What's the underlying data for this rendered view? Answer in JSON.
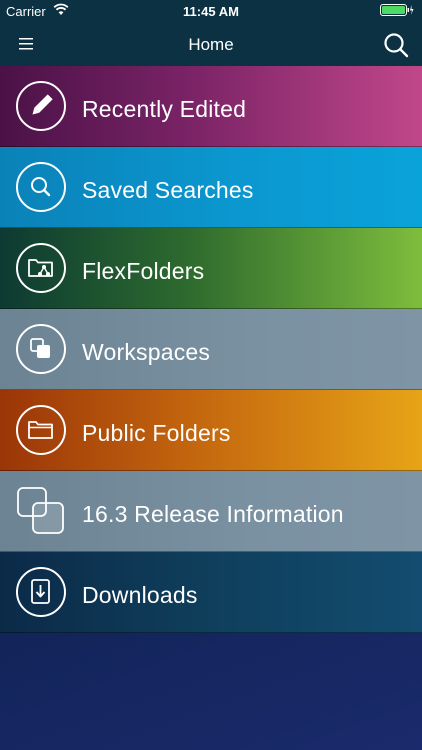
{
  "status_bar": {
    "carrier": "Carrier",
    "time": "11:45 AM",
    "icons": [
      "wifi-icon",
      "battery-icon"
    ]
  },
  "nav": {
    "title": "Home",
    "icons": [
      "hamburger-menu-icon",
      "search-icon"
    ]
  },
  "colors": {
    "nav_bg": "#0b3142",
    "icon_stroke": "#ffffff"
  },
  "menu": [
    {
      "label": "Recently Edited",
      "icon": "pencil-icon"
    },
    {
      "label": "Saved Searches",
      "icon": "search-icon"
    },
    {
      "label": "FlexFolders",
      "icon": "flexfolder-icon"
    },
    {
      "label": "Workspaces",
      "icon": "workspaces-icon"
    },
    {
      "label": "Public Folders",
      "icon": "folder-icon"
    },
    {
      "label": "16.3 Release Information",
      "icon": "release-info-icon"
    },
    {
      "label": "Downloads",
      "icon": "download-icon"
    }
  ]
}
